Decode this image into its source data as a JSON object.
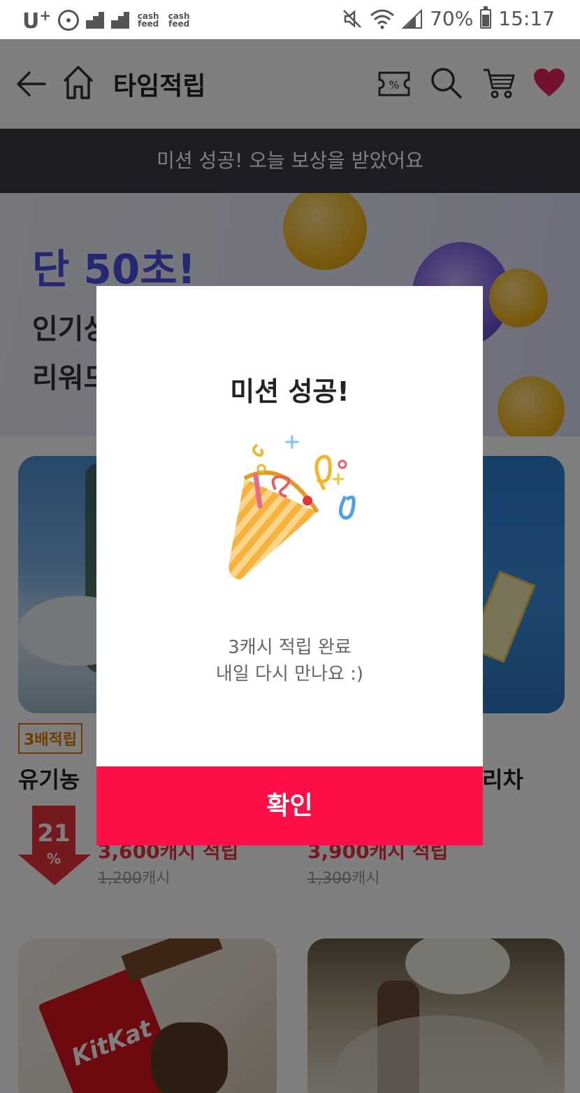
{
  "status_bar": {
    "carrier": "U",
    "carrier_sup": "+",
    "cash_feed_1": "cash feed",
    "cash_feed_2": "cash feed",
    "battery": "70%",
    "time": "15:17"
  },
  "header": {
    "title": "타임적립",
    "icons": [
      "back-arrow-icon",
      "home-icon",
      "coupon-icon",
      "search-icon",
      "cart-icon",
      "heart-icon"
    ],
    "heart_color": "#e5245a"
  },
  "notice_banner": {
    "text": "미션 성공! 오늘 보상을 받았어요"
  },
  "hero": {
    "headline": "단 50초!",
    "line2": "인기상",
    "line3": "리워드",
    "headline_color": "#4a4fe0"
  },
  "products": {
    "left": {
      "badge": "3배적립",
      "name": "유기농 ",
      "discount_value": "21",
      "discount_sign": "%",
      "price": "3,600캐시 적립",
      "old_price_value": "1,200",
      "old_price_unit": "캐시"
    },
    "right": {
      "name": "리차",
      "price": "3,900캐시 적립",
      "old_price_value": "1,300",
      "old_price_unit": "캐시"
    },
    "kitkat_label": "KitKat"
  },
  "modal": {
    "title": "미션 성공!",
    "message_line1": "3캐시 적립 완료",
    "message_line2": "내일 다시 만나요 :)",
    "confirm_label": "확인",
    "confirm_color": "#ff0f47"
  }
}
